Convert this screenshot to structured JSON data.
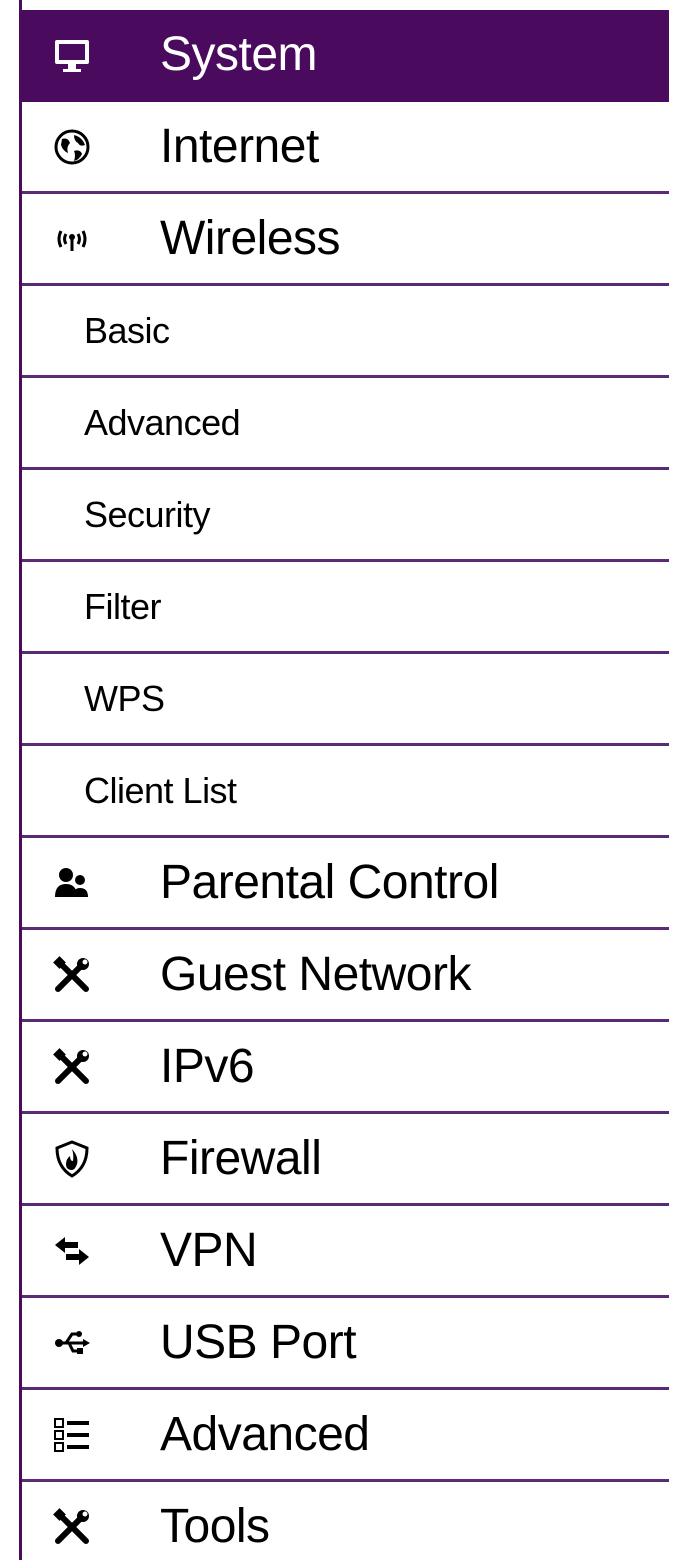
{
  "colors": {
    "accent": "#4a0a5e",
    "divider": "#5a2a74",
    "active_text": "#ffffff",
    "text": "#000000"
  },
  "menu": {
    "items": [
      {
        "label": "System",
        "icon": "monitor-icon",
        "active": true
      },
      {
        "label": "Internet",
        "icon": "globe-icon"
      },
      {
        "label": "Wireless",
        "icon": "wireless-icon"
      },
      {
        "label": "Basic",
        "sub": true
      },
      {
        "label": "Advanced",
        "sub": true
      },
      {
        "label": "Security",
        "sub": true
      },
      {
        "label": "Filter",
        "sub": true
      },
      {
        "label": "WPS",
        "sub": true
      },
      {
        "label": "Client List",
        "sub": true
      },
      {
        "label": "Parental Control",
        "icon": "users-icon"
      },
      {
        "label": "Guest Network",
        "icon": "tools-icon"
      },
      {
        "label": "IPv6",
        "icon": "tools-icon"
      },
      {
        "label": "Firewall",
        "icon": "shield-fire-icon"
      },
      {
        "label": "VPN",
        "icon": "exchange-arrows-icon"
      },
      {
        "label": "USB Port",
        "icon": "usb-icon"
      },
      {
        "label": "Advanced",
        "icon": "list-icon"
      },
      {
        "label": "Tools",
        "icon": "tools-icon"
      }
    ]
  }
}
